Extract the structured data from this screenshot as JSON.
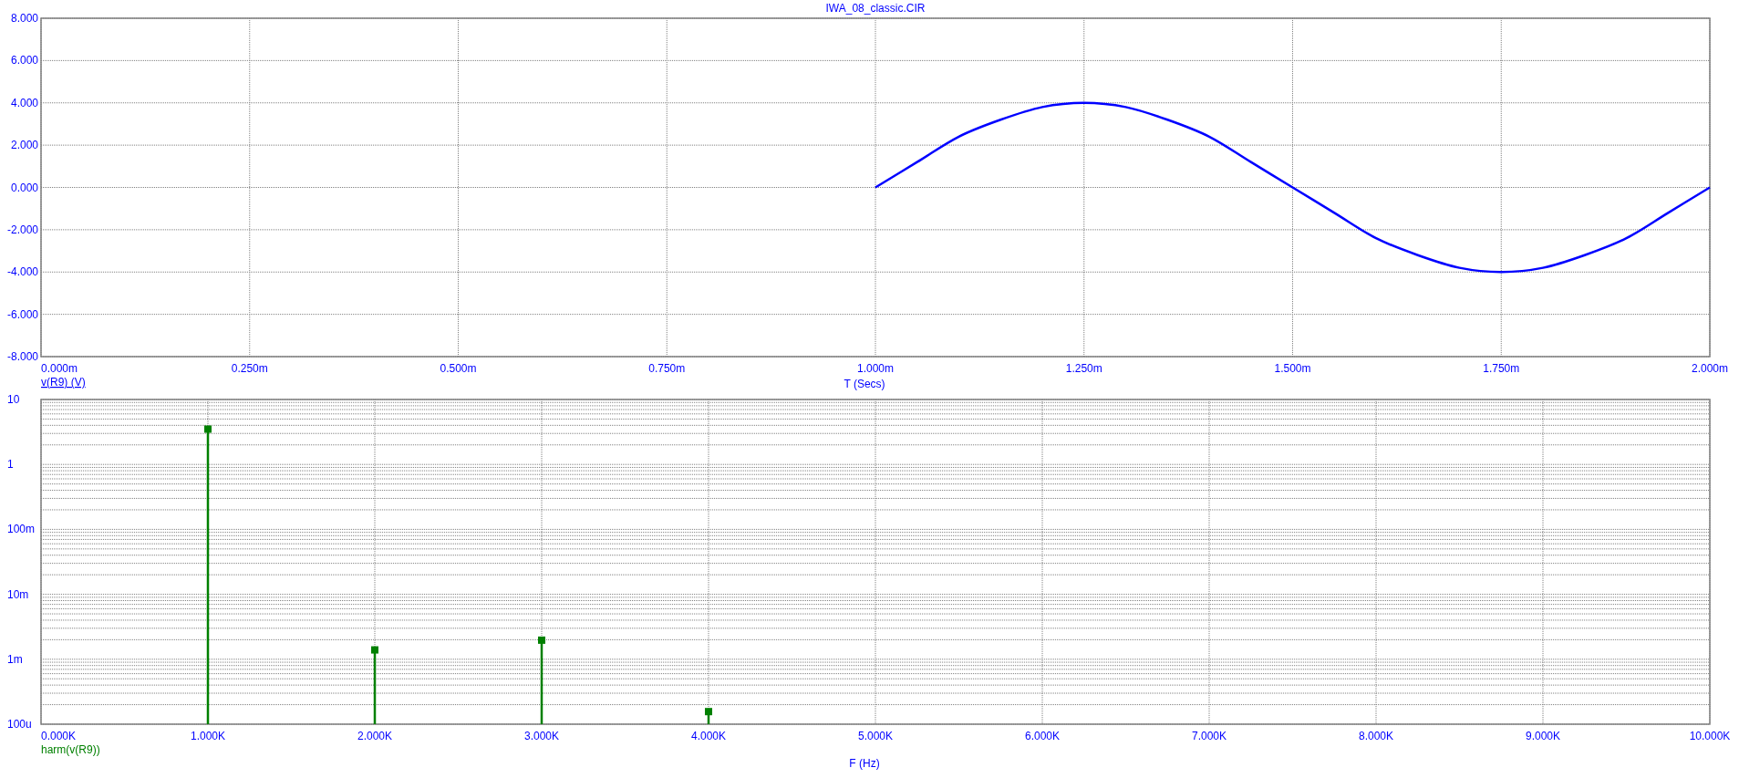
{
  "plots": [
    {
      "chart_data": {
        "type": "line",
        "title": "IWA_08_classic.CIR",
        "xlabel": "T (Secs)",
        "xlim": [
          0,
          2
        ],
        "ylim": [
          -8,
          8
        ],
        "grid": true,
        "xticks": [
          {
            "value": 0,
            "label": "0.000m"
          },
          {
            "value": 0.25,
            "label": "0.250m"
          },
          {
            "value": 0.5,
            "label": "0.500m"
          },
          {
            "value": 0.75,
            "label": "0.750m"
          },
          {
            "value": 1,
            "label": "1.000m"
          },
          {
            "value": 1.25,
            "label": "1.250m"
          },
          {
            "value": 1.5,
            "label": "1.500m"
          },
          {
            "value": 1.75,
            "label": "1.750m"
          },
          {
            "value": 2,
            "label": "2.000m"
          }
        ],
        "yticks": [
          {
            "value": 8,
            "label": "8.000"
          },
          {
            "value": 6,
            "label": "6.000"
          },
          {
            "value": 4,
            "label": "4.000"
          },
          {
            "value": 2,
            "label": "2.000"
          },
          {
            "value": 0,
            "label": "0.000"
          },
          {
            "value": -2,
            "label": "-2.000"
          },
          {
            "value": -4,
            "label": "-4.000"
          },
          {
            "value": -6,
            "label": "-6.000"
          },
          {
            "value": -8,
            "label": "-8.000"
          }
        ],
        "x": [
          1,
          1.05,
          1.1,
          1.15,
          1.2,
          1.25,
          1.3,
          1.35,
          1.4,
          1.45,
          1.5,
          1.55,
          1.6,
          1.65,
          1.7,
          1.75,
          1.8,
          1.85,
          1.9,
          1.95,
          2
        ],
        "series": [
          {
            "name": "v(R9) (V)",
            "color": "#0000ff",
            "values": [
              0,
              1.2,
              2.4,
              3.2,
              3.8,
              4,
              3.8,
              3.2,
              2.4,
              1.2,
              0,
              -1.2,
              -2.4,
              -3.2,
              -3.8,
              -4,
              -3.8,
              -3.2,
              -2.4,
              -1.2,
              0
            ]
          }
        ]
      }
    },
    {
      "spectrum": {
        "y_axis_labels": [
          "10",
          "1",
          "100m",
          "10m",
          "1m",
          "100u"
        ],
        "x_axis": [
          {
            "label": "0.000K"
          },
          {
            "label": "1.000K",
            "level": 0.92
          },
          {
            "label": "2.000K",
            "level": 0.24
          },
          {
            "label": "3.000K",
            "level": 0.27
          },
          {
            "label": "4.000K",
            "level": 0.05
          },
          {
            "label": "5.000K"
          },
          {
            "label": "6.000K"
          },
          {
            "label": "7.000K"
          },
          {
            "label": "8.000K"
          },
          {
            "label": "9.000K"
          },
          {
            "label": "10.000K"
          }
        ],
        "trace_name": "harm(v(R9))",
        "x_axis_title": "F (Hz)"
      }
    }
  ]
}
